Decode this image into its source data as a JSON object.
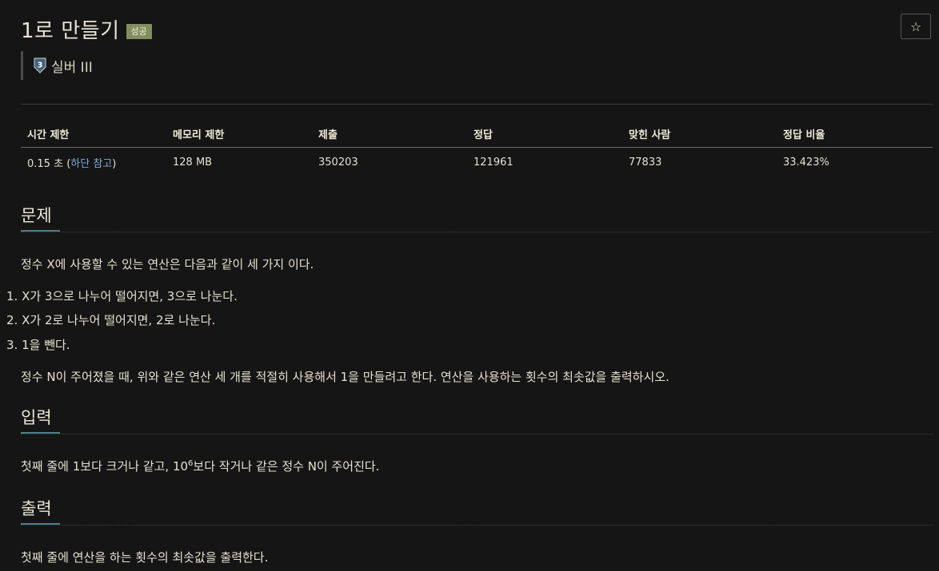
{
  "problem": {
    "title": "1로 만들기",
    "status_badge": "성공",
    "star_glyph": "☆",
    "tier": {
      "number": "3",
      "label": "실버 III",
      "color": "#435f7a"
    }
  },
  "info_table": {
    "headers": [
      "시간 제한",
      "메모리 제한",
      "제출",
      "정답",
      "맞힌 사람",
      "정답 비율"
    ],
    "time_limit": "0.15 초",
    "time_note_open": "(",
    "time_note_link": "하단 참고",
    "time_note_close": ")",
    "memory_limit": "128 MB",
    "submissions": "350203",
    "correct": "121961",
    "solvers": "77833",
    "ratio": "33.423%"
  },
  "sections": {
    "problem": {
      "title": "문제",
      "intro": "정수 X에 사용할 수 있는 연산은 다음과 같이 세 가지 이다.",
      "list": [
        "X가 3으로 나누어 떨어지면, 3으로 나눈다.",
        "X가 2로 나누어 떨어지면, 2로 나눈다.",
        "1을 뺀다."
      ],
      "outro": "정수 N이 주어졌을 때, 위와 같은 연산 세 개를 적절히 사용해서 1을 만들려고 한다. 연산을 사용하는 횟수의 최솟값을 출력하시오."
    },
    "input": {
      "title": "입력",
      "text_before": "첫째 줄에 1보다 크거나 같고, 10",
      "sup": "6",
      "text_after": "보다 작거나 같은 정수 N이 주어진다."
    },
    "output": {
      "title": "출력",
      "text": "첫째 줄에 연산을 하는 횟수의 최솟값을 출력한다."
    }
  }
}
